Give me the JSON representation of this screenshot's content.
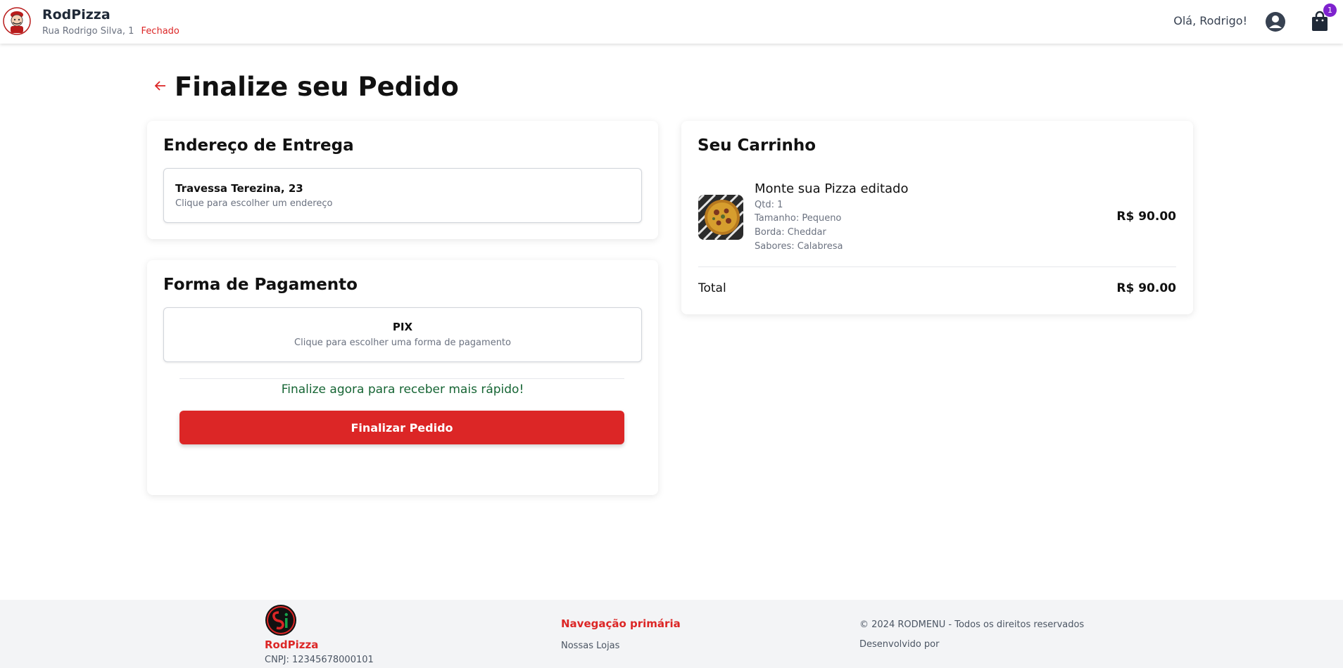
{
  "header": {
    "brand": "RodPizza",
    "address": "Rua Rodrigo Silva, 1",
    "status": "Fechado",
    "greeting": "Olá, Rodrigo!",
    "cart_count": "1"
  },
  "page": {
    "title": "Finalize seu Pedido"
  },
  "address_card": {
    "title": "Endereço de Entrega",
    "address": "Travessa Terezina, 23",
    "hint": "Clique para escolher um endereço"
  },
  "payment_card": {
    "title": "Forma de Pagamento",
    "method": "PIX",
    "hint": "Clique para escolher uma forma de pagamento",
    "promo": "Finalize agora para receber mais rápido!",
    "button": "Finalizar Pedido"
  },
  "cart": {
    "title": "Seu Carrinho",
    "items": [
      {
        "name": "Monte sua Pizza editado",
        "qty": "Qtd: 1",
        "size": "Tamanho: Pequeno",
        "crust": "Borda: Cheddar",
        "flavors": "Sabores: Calabresa",
        "price": "R$ 90.00"
      }
    ],
    "total_label": "Total",
    "total_value": "R$ 90.00"
  },
  "footer": {
    "brand": "RodPizza",
    "cnpj": "CNPJ: 12345678000101",
    "nav_title": "Navegação primária",
    "nav_link": "Nossas Lojas",
    "copyright": "© 2024 RODMENU - Todos os direitos reservados",
    "developed_by": "Desenvolvido por"
  },
  "colors": {
    "accent": "#dc2626",
    "promo": "#166534",
    "badge": "#7e22ce"
  }
}
